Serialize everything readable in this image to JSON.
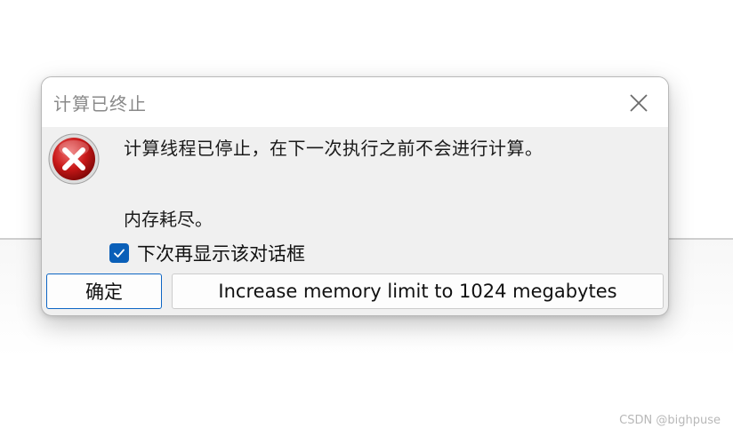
{
  "dialog": {
    "title": "计算已终止",
    "message_line1": "计算线程已停止，在下一次执行之前不会进行计算。",
    "message_line2": "内存耗尽。",
    "checkbox": {
      "label": "下次再显示该对话框",
      "checked": true
    },
    "buttons": {
      "ok_label": "确定",
      "memory_label": "Increase memory limit to 1024 megabytes"
    },
    "icons": {
      "status": "error-icon",
      "close": "close-icon"
    }
  },
  "watermark": "CSDN @bighpuse",
  "colors": {
    "checkbox_accent": "#0a5fb8",
    "default_button_border": "#0e66c4",
    "error_red": "#c81818"
  }
}
